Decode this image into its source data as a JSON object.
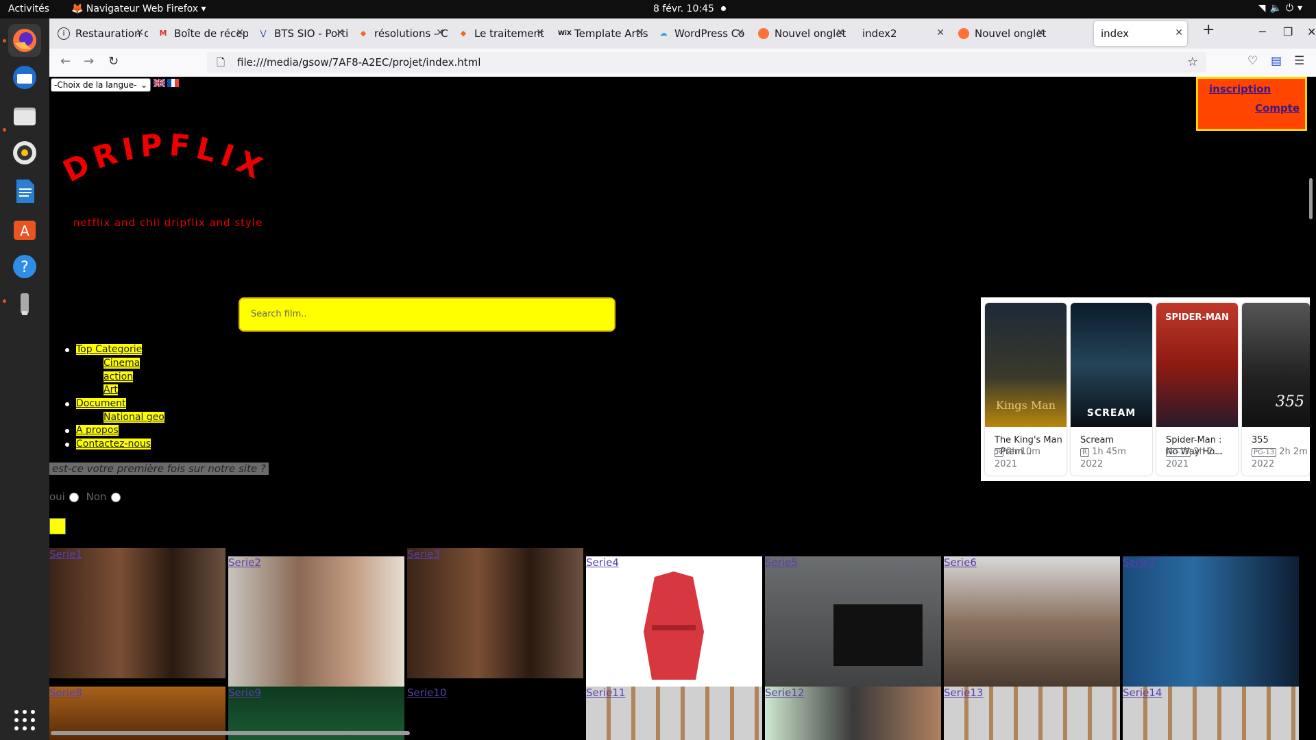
{
  "system": {
    "activities": "Activités",
    "app_name": "Navigateur Web Firefox",
    "clock": "8 févr.  10:45"
  },
  "browser": {
    "tabs": [
      {
        "label": "Restauration d",
        "icon": "info-icon"
      },
      {
        "label": "Boîte de récep",
        "icon": "gmail-icon"
      },
      {
        "label": "BTS SIO - Porti",
        "icon": "bts-icon"
      },
      {
        "label": "résolutions - C",
        "icon": "orange-diamond-icon"
      },
      {
        "label": "Le traitement",
        "icon": "orange-diamond-icon"
      },
      {
        "label": "Template Artis",
        "icon": "wix-icon"
      },
      {
        "label": "WordPress Co",
        "icon": "cloud-icon"
      },
      {
        "label": "Nouvel onglet",
        "icon": "firefox-icon"
      },
      {
        "label": "index2",
        "icon": ""
      },
      {
        "label": "Nouvel onglet",
        "icon": "firefox-icon"
      },
      {
        "label": "index",
        "icon": ""
      }
    ],
    "url": "file:///media/gsow/7AF8-A2EC/projet/index.html"
  },
  "page": {
    "lang_select": "-Choix de la langue-",
    "logo": "DRIPFLIX",
    "tagline": "netflix and chil dripflix and style",
    "account": {
      "inscription": "inscription",
      "compte": "Compte"
    },
    "search_placeholder": "Search film..",
    "menu": {
      "top_categorie": "Top Categorie",
      "cinema": "Cinema",
      "action": "action",
      "art": "Art",
      "document": "Document",
      "national_geo": "National geo",
      "a_propos": "A propos",
      "contact": "Contactez-nous"
    },
    "question": "est-ce votre première fois sur notre site ?",
    "yes": "oui",
    "no": "Non",
    "movies": [
      {
        "title": "The King's Man : Prem...",
        "rating": "R",
        "duration": "2h 10m",
        "year": "2021",
        "poster_text": "Kings Man"
      },
      {
        "title": "Scream",
        "rating": "R",
        "duration": "1h 45m",
        "year": "2022",
        "poster_text": "SCREAM"
      },
      {
        "title": "Spider-Man : No Way Ho...",
        "rating": "PG-13",
        "duration": "2h 2...",
        "year": "2021",
        "poster_text": "SPIDER-MAN"
      },
      {
        "title": "355",
        "rating": "PG-13",
        "duration": "2h 2m",
        "year": "2022",
        "poster_text": "355"
      }
    ],
    "series": [
      "Serie1",
      "Serie2",
      "Serie3",
      "Serie4",
      "Serie5",
      "Serie6",
      "Serie7",
      "Serie8",
      "Serie9",
      "Serie10",
      "Serie11",
      "Serie12",
      "Serie13",
      "Serie14"
    ]
  }
}
